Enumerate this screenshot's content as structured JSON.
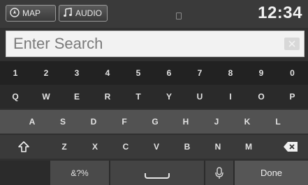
{
  "header": {
    "tab_map": "MAP",
    "tab_audio": "AUDIO",
    "clock": "12:34"
  },
  "search": {
    "placeholder": "Enter Search"
  },
  "keyboard": {
    "row_numbers": [
      "1",
      "2",
      "3",
      "4",
      "5",
      "6",
      "7",
      "8",
      "9",
      "0"
    ],
    "row_top": [
      "Q",
      "W",
      "E",
      "R",
      "T",
      "Y",
      "U",
      "I",
      "O",
      "P"
    ],
    "row_home": [
      "A",
      "S",
      "D",
      "F",
      "G",
      "H",
      "J",
      "K",
      "L"
    ],
    "row_bottom": [
      "Z",
      "X",
      "C",
      "V",
      "B",
      "N",
      "M"
    ],
    "symbols_label": "&?%",
    "done_label": "Done"
  },
  "icons": {
    "map": "compass-icon",
    "audio": "music-note-icon",
    "clear": "clear-icon",
    "shift": "shift-icon",
    "backspace": "backspace-icon",
    "space": "space-icon",
    "voice": "microphone-icon"
  }
}
